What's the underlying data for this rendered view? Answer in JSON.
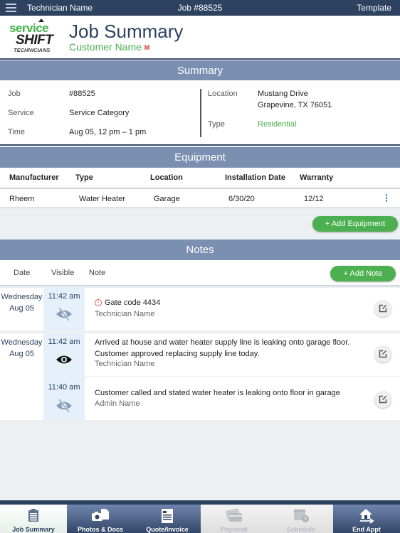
{
  "topbar": {
    "menu_icon": "hamburger-menu-icon",
    "technician": "Technician Name",
    "job": "Job #88525",
    "template": "Template"
  },
  "header": {
    "logo": {
      "line1": "service",
      "line2": "SHIFT",
      "line3": "TECHNICIANS"
    },
    "title": "Job Summary",
    "customer": "Customer Name",
    "customer_badge": "M"
  },
  "summary": {
    "section_title": "Summary",
    "left": [
      {
        "label": "Job",
        "value": "#88525"
      },
      {
        "label": "Service",
        "value": "Service Category"
      },
      {
        "label": "Time",
        "value": "Aug 05, 12 pm – 1 pm"
      }
    ],
    "right": {
      "location_label": "Location",
      "location_line1": "Mustang Drive",
      "location_line2": "Grapevine, TX 76051",
      "type_label": "Type",
      "type_value": "Residential"
    }
  },
  "equipment": {
    "section_title": "Equipment",
    "columns": [
      "Manufacturer",
      "Type",
      "Location",
      "Installation Date",
      "Warranty"
    ],
    "rows": [
      {
        "manufacturer": "Rheem",
        "type": "Water Heater",
        "location": "Garage",
        "install_date": "6/30/20",
        "warranty": "12/12"
      }
    ],
    "add_button": "+ Add Equipment"
  },
  "notes": {
    "section_title": "Notes",
    "columns": [
      "Date",
      "Visible",
      "Note"
    ],
    "add_button": "+ Add Note",
    "items": [
      {
        "day": "Wednesday",
        "date": "Aug 05",
        "time": "11:42 am",
        "visible": false,
        "alert": true,
        "text": "Gate code 4434",
        "author": "Technician Name"
      },
      {
        "day": "Wednesday",
        "date": "Aug 05",
        "time": "11:42 am",
        "visible": true,
        "alert": false,
        "text_line1": "Arrived at house and water heater supply line is leaking onto garage floor.",
        "text_line2": "Customer approved replacing supply line today.",
        "author": "Technician Name"
      },
      {
        "time": "11:40 am",
        "visible": false,
        "alert": false,
        "text": "Customer called and stated water heater is leaking onto floor in garage",
        "author": "Admin Name"
      }
    ]
  },
  "tabs": [
    {
      "label": "Job Summary",
      "icon": "clipboard-icon",
      "state": "active"
    },
    {
      "label": "Photos & Docs",
      "icon": "camera-document-icon",
      "state": "enabled"
    },
    {
      "label": "Quote/Invoice",
      "icon": "invoice-icon",
      "state": "enabled"
    },
    {
      "label": "Payment",
      "icon": "credit-card-icon",
      "state": "disabled"
    },
    {
      "label": "Schedule",
      "icon": "calendar-clock-icon",
      "state": "disabled"
    },
    {
      "label": "End Appt",
      "icon": "house-exit-icon",
      "state": "enabled"
    }
  ],
  "colors": {
    "navy": "#2d4161",
    "section_bar": "#7b8fb1",
    "accent_green": "#4caf50",
    "alert_red": "#e05555"
  }
}
